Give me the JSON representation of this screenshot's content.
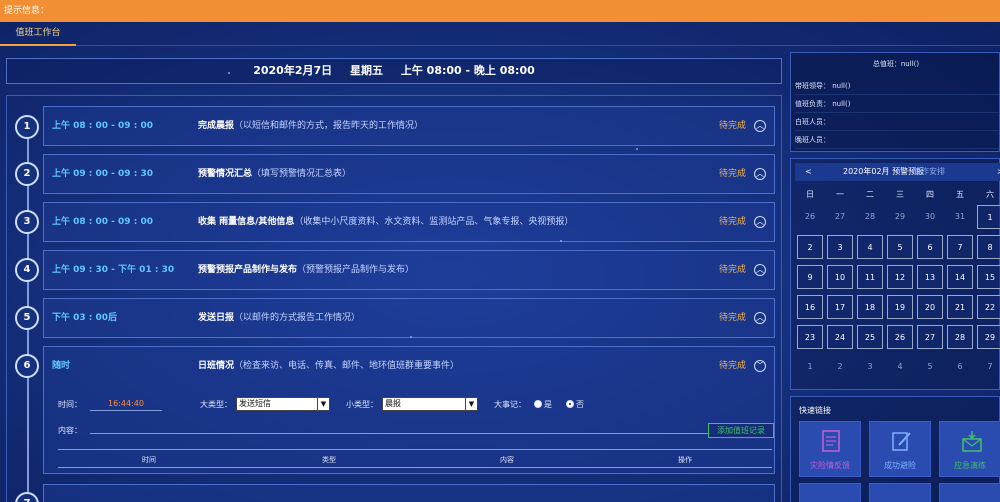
{
  "topbar": {
    "title": "提示信息："
  },
  "tabs": [
    {
      "label": "值班工作台"
    }
  ],
  "datebar": {
    "date": "2020年2月7日",
    "weekday": "星期五",
    "shift": "上午 08:00 - 晚上 08:00"
  },
  "tasks": [
    {
      "num": "1",
      "time": "上午 08 : 00 - 09 : 00",
      "name": "完成晨报",
      "desc": "（以短信和邮件的方式，报告昨天的工作情况）",
      "status": "待完成"
    },
    {
      "num": "2",
      "time": "上午 09 : 00 - 09 : 30",
      "name": "预警情况汇总",
      "desc": "（填写预警情况汇总表）",
      "status": "待完成"
    },
    {
      "num": "3",
      "time": "上午 08 : 00 - 09 : 00",
      "name": "收集 雨量信息/其他信息",
      "desc": "（收集中小尺度资料、水文资料、监测站产品、气象专报、央视预报）",
      "status": "待完成"
    },
    {
      "num": "4",
      "time": "上午 09 : 30 - 下午 01 : 30",
      "name": "预警预报产品制作与发布",
      "desc": "（预警预报产品制作与发布）",
      "status": "待完成"
    },
    {
      "num": "5",
      "time": "下午 03 : 00后",
      "name": "发送日报",
      "desc": "（以邮件的方式报告工作情况）",
      "status": "待完成"
    },
    {
      "num": "6",
      "time": "随时",
      "name": "日班情况",
      "desc": "（检查来访、电话、传真、邮件、地环值班群重要事件）",
      "status": "待完成"
    }
  ],
  "form": {
    "time_label": "时间：",
    "time_value": "16:44:40",
    "big_type_label": "大类型：",
    "big_type_value": "发送短信",
    "small_type_label": "小类型：",
    "small_type_value": "晨报",
    "major_label": "大事记：",
    "yes": "是",
    "no": "否",
    "content_label": "内容：",
    "add_button": "添加值班记录",
    "table_headers": [
      "时间",
      "类型",
      "内容",
      "操作"
    ]
  },
  "info": {
    "title": "总值班：null()",
    "rows": [
      "带班领导： null()",
      "值班负责： null()",
      "白班人员：",
      "晚班人员："
    ]
  },
  "calendar": {
    "prev": "<",
    "title": "2020年02月 预警预报",
    "tag": "工作安排",
    "next": ">",
    "weekdays": [
      "日",
      "一",
      "二",
      "三",
      "四",
      "五",
      "六"
    ],
    "weeks": [
      [
        "26",
        "27",
        "28",
        "29",
        "30",
        "31",
        "1"
      ],
      [
        "2",
        "3",
        "4",
        "5",
        "6",
        "7",
        "8"
      ],
      [
        "9",
        "10",
        "11",
        "12",
        "13",
        "14",
        "15"
      ],
      [
        "16",
        "17",
        "18",
        "19",
        "20",
        "21",
        "22"
      ],
      [
        "23",
        "24",
        "25",
        "26",
        "27",
        "28",
        "29"
      ],
      [
        "1",
        "2",
        "3",
        "4",
        "5",
        "6",
        "7"
      ]
    ]
  },
  "quick": {
    "title": "快速链接",
    "tiles": [
      {
        "label": "灾险情反馈",
        "color": "#c45fd8"
      },
      {
        "label": "成功避险",
        "color": "#7fb0ff"
      },
      {
        "label": "应急演练",
        "color": "#3fbf6a"
      }
    ]
  }
}
